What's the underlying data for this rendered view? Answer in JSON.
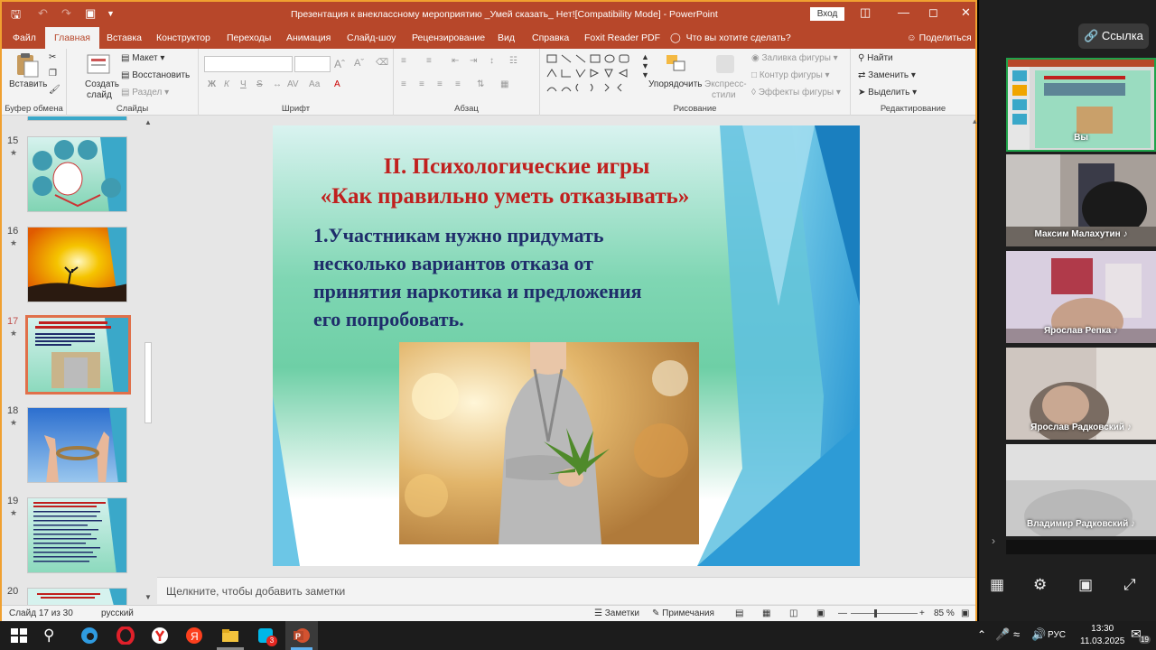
{
  "window": {
    "title": "Презентация к внеклассному мероприятию _Умей сказать_ Нет![Compatibility Mode]  -  PowerPoint",
    "signin": "Вход"
  },
  "tabs": [
    "Файл",
    "Главная",
    "Вставка",
    "Конструктор",
    "Переходы",
    "Анимация",
    "Слайд-шоу",
    "Рецензирование",
    "Вид",
    "Справка",
    "Foxit Reader PDF"
  ],
  "tell_me": "Что вы хотите сделать?",
  "share": "Поделиться",
  "ribbon": {
    "clipboard": {
      "paste": "Вставить",
      "label": "Буфер обмена"
    },
    "slides": {
      "new_slide_1": "Создать",
      "new_slide_2": "слайд",
      "layout": "Макет",
      "reset": "Восстановить",
      "section": "Раздел",
      "label": "Слайды"
    },
    "font": {
      "label": "Шрифт",
      "bold": "Ж",
      "italic": "К",
      "underline": "Ч",
      "strike": "S",
      "font_case": "Аа"
    },
    "paragraph": {
      "label": "Абзац"
    },
    "drawing": {
      "arrange": "Упорядочить",
      "quick_styles_1": "Экспресс-",
      "quick_styles_2": "стили",
      "fill": "Заливка фигуры",
      "outline": "Контур фигуры",
      "effects": "Эффекты фигуры",
      "label": "Рисование"
    },
    "editing": {
      "find": "Найти",
      "replace": "Заменить",
      "select": "Выделить",
      "label": "Редактирование"
    }
  },
  "thumbnails": [
    {
      "num": "15"
    },
    {
      "num": "16"
    },
    {
      "num": "17"
    },
    {
      "num": "18"
    },
    {
      "num": "19"
    },
    {
      "num": "20"
    }
  ],
  "slide": {
    "title_line1": "II. Психологические игры",
    "title_line2": "«Как правильно уметь отказывать»",
    "body_line1": "1.Участникам нужно придумать",
    "body_line2": "несколько вариантов отказа от",
    "body_line3": "принятия наркотика и предложения",
    "body_line4": "его попробовать."
  },
  "notes_placeholder": "Щелкните, чтобы добавить заметки",
  "status": {
    "slide_counter": "Слайд 17 из 30",
    "language": "русский",
    "notes": "Заметки",
    "comments": "Примечания",
    "zoom": "85 %"
  },
  "call": {
    "link_button": "Ссылка",
    "participants": [
      {
        "name": "Вы"
      },
      {
        "name": "Максим Малахутин"
      },
      {
        "name": "Ярослав Репка"
      },
      {
        "name": "Ярослав Радковский"
      },
      {
        "name": "Владимир Радковский"
      }
    ]
  },
  "taskbar": {
    "lang": "РУС",
    "time": "13:30",
    "date": "11.03.2025",
    "badge": "3",
    "notif": "19"
  },
  "colors": {
    "ppt_accent": "#b7472a",
    "slide_title": "#c0201e",
    "slide_body": "#1f2d6b",
    "selection": "#e0704a"
  }
}
